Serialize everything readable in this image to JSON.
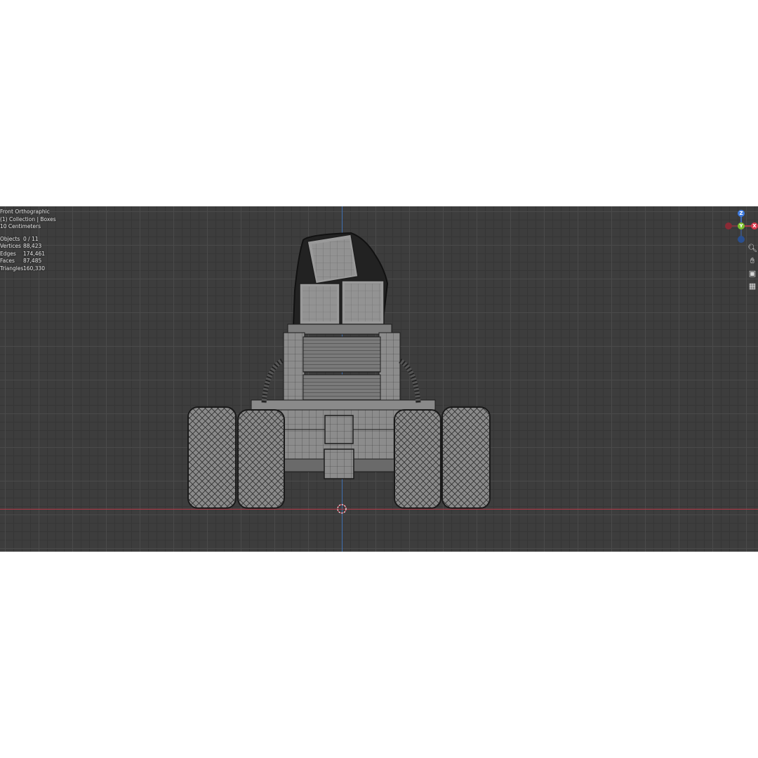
{
  "viewport": {
    "view_name": "Front Orthographic",
    "collection_line": "(1) Collection | Boxes",
    "scale_line": "10 Centimeters",
    "stats": [
      {
        "label": "Objects",
        "value": "0 / 11"
      },
      {
        "label": "Vertices",
        "value": "88,423"
      },
      {
        "label": "Edges",
        "value": "174,461"
      },
      {
        "label": "Faces",
        "value": "87,485"
      },
      {
        "label": "Triangles",
        "value": "160,330"
      }
    ]
  },
  "gizmo": {
    "z_label": "Z",
    "y_label": "Y",
    "x_label": "X",
    "colors": {
      "x": "#d63a4c",
      "y": "#7cc12d",
      "z": "#3e7be0"
    }
  },
  "tools": [
    {
      "name": "zoom-icon"
    },
    {
      "name": "hand-icon"
    },
    {
      "name": "camera-icon"
    },
    {
      "name": "grid-icon"
    }
  ],
  "colors": {
    "background": "#3d3d3d",
    "axis_x": "#b23a48",
    "axis_z": "#3f6fb0"
  }
}
